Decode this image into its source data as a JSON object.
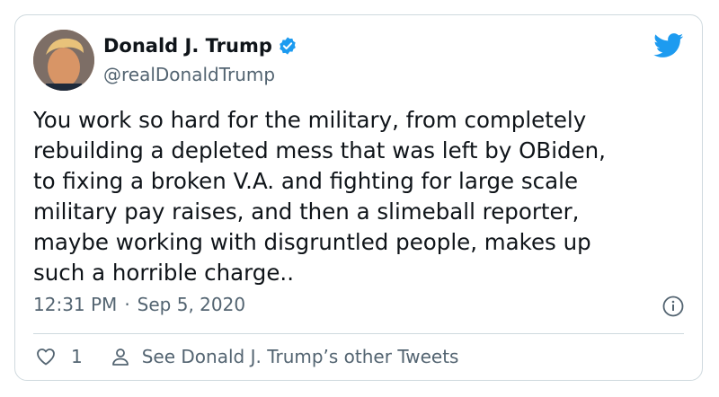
{
  "tweet": {
    "author_name": "Donald J. Trump",
    "handle": "@realDonaldTrump",
    "text": "You work so hard for the military, from completely\nrebuilding a depleted mess that was left by OBiden,\nto fixing a broken V.A. and fighting for large scale\nmilitary pay raises, and then a slimeball reporter,\nmaybe working with disgruntled people, makes up\nsuch a horrible charge..",
    "time": "12:31 PM",
    "separator": "·",
    "date": "Sep 5, 2020",
    "like_count": "1",
    "see_other_label": "See Donald J. Trump’s other Tweets"
  },
  "colors": {
    "text": "#0f1419",
    "secondary": "#536471",
    "accent": "#1d9bf0",
    "border": "#cfd9de"
  },
  "icons": {
    "brand": "twitter-bird-icon",
    "verified": "verified-badge-icon",
    "info": "info-icon",
    "like": "heart-icon",
    "profile": "person-icon"
  }
}
